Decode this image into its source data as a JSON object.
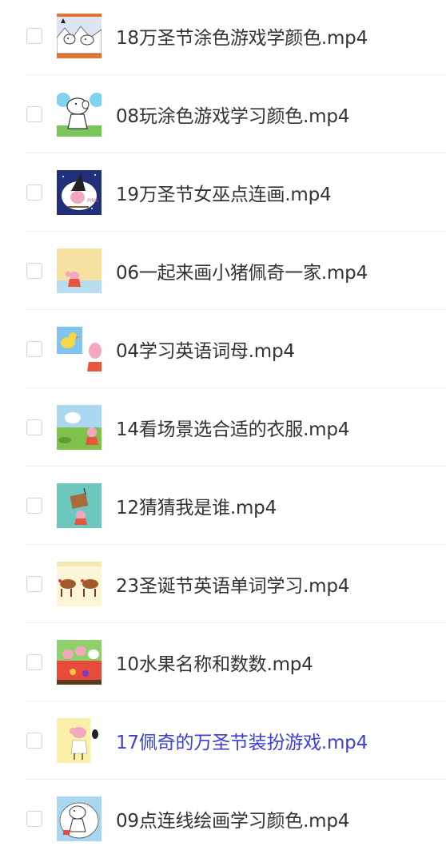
{
  "files": [
    {
      "name": "18万圣节涂色游戏学颜色.mp4",
      "thumb": "halloween-coloring",
      "active": false
    },
    {
      "name": "08玩涂色游戏学习颜色.mp4",
      "thumb": "peppa-coloring",
      "active": false
    },
    {
      "name": "19万圣节女巫点连画.mp4",
      "thumb": "witch-dots",
      "active": false
    },
    {
      "name": "06一起来画小猪佩奇一家.mp4",
      "thumb": "peppa-family",
      "active": false
    },
    {
      "name": "04学习英语词母.mp4",
      "thumb": "duck-letters",
      "active": false
    },
    {
      "name": "14看场景选合适的衣服.mp4",
      "thumb": "outdoor-scene",
      "active": false
    },
    {
      "name": "12猜猜我是谁.mp4",
      "thumb": "guess-who",
      "active": false
    },
    {
      "name": "23圣诞节英语单词学习.mp4",
      "thumb": "reindeer",
      "active": false
    },
    {
      "name": "10水果名称和数数.mp4",
      "thumb": "picnic-fruit",
      "active": false
    },
    {
      "name": "17佩奇的万圣节装扮游戏.mp4",
      "thumb": "halloween-dressup",
      "active": true
    },
    {
      "name": "09点连线绘画学习颜色.mp4",
      "thumb": "dot-drawing",
      "active": false
    }
  ],
  "thumb_colors": {
    "active_text": "#3a3fd8",
    "text": "#333333"
  }
}
